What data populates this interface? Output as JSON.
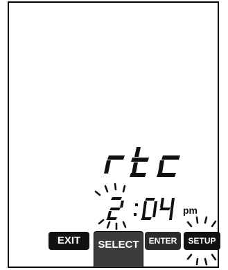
{
  "display": {
    "label": "rtc",
    "time": {
      "hour": "2",
      "separator": ":",
      "minutes": "04",
      "meridiem": "pm"
    }
  },
  "buttons": {
    "exit": "EXIT",
    "select": "SELECT",
    "enter": "ENTER",
    "setup": "SETUP"
  },
  "colors": {
    "segment": "#111111",
    "button": "#111111",
    "select_button": "#3c3c3c"
  }
}
